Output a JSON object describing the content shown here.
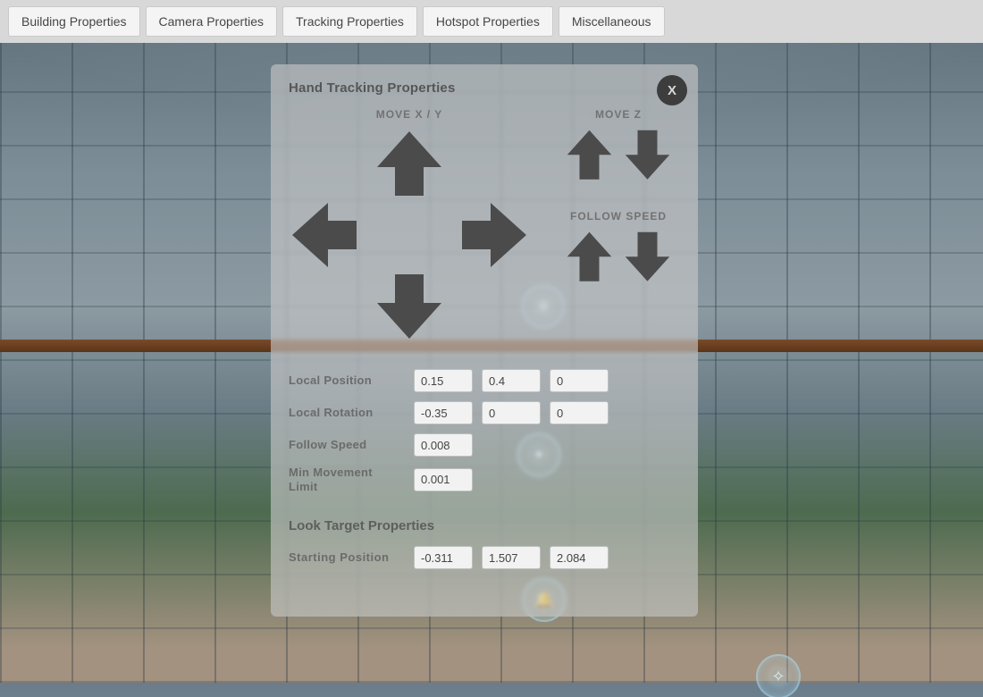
{
  "toolbar": {
    "building": "Building Properties",
    "camera": "Camera Properties",
    "tracking": "Tracking Properties",
    "hotspot": "Hotspot Properties",
    "misc": "Miscellaneous"
  },
  "panel": {
    "title": "Hand Tracking Properties",
    "close_label": "X",
    "move_xy_label": "MOVE X / Y",
    "move_z_label": "MOVE Z",
    "follow_speed_section_label": "FOLLOW SPEED",
    "local_position_label": "Local Position",
    "local_position": {
      "x": "0.15",
      "y": "0.4",
      "z": "0"
    },
    "local_rotation_label": "Local Rotation",
    "local_rotation": {
      "x": "-0.35",
      "y": "0",
      "z": "0"
    },
    "follow_speed_label": "Follow Speed",
    "follow_speed": "0.008",
    "min_movement_label": "Min Movement Limit",
    "min_movement": "0.001",
    "look_target_title": "Look Target Properties",
    "starting_position_label": "Starting Position",
    "starting_position": {
      "x": "-0.311",
      "y": "1.507",
      "z": "2.084"
    }
  }
}
